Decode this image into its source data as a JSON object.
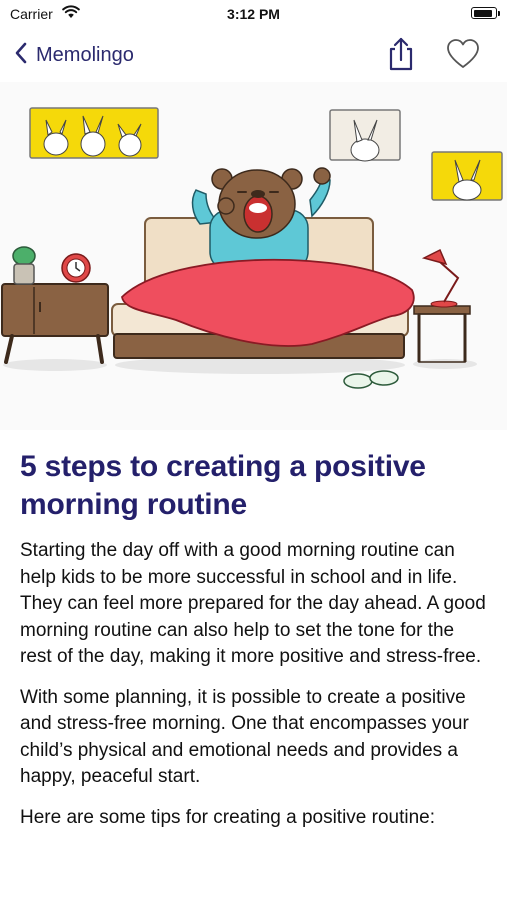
{
  "status_bar": {
    "carrier": "Carrier",
    "time": "3:12 PM",
    "battery_level": 0.9
  },
  "nav": {
    "back_label": "Memolingo",
    "share_icon": "share-icon",
    "favorite_icon": "heart-icon",
    "accent_color": "#2b2a6e"
  },
  "article": {
    "title": "5 steps to creating a positive morning routine",
    "paragraphs": [
      "Starting the day off with a good morning routine can help kids to be more successful in school and in life. They can feel more prepared for the day ahead. A good morning routine can also help to set the tone for the rest of the day, making it more positive and stress-free.",
      "With some planning, it is possible to create a positive and stress-free morning. One that encompasses your child’s physical and emotional needs and provides a happy, peaceful start.",
      "Here are some tips for creating a positive routine:"
    ],
    "title_color": "#24206b"
  }
}
